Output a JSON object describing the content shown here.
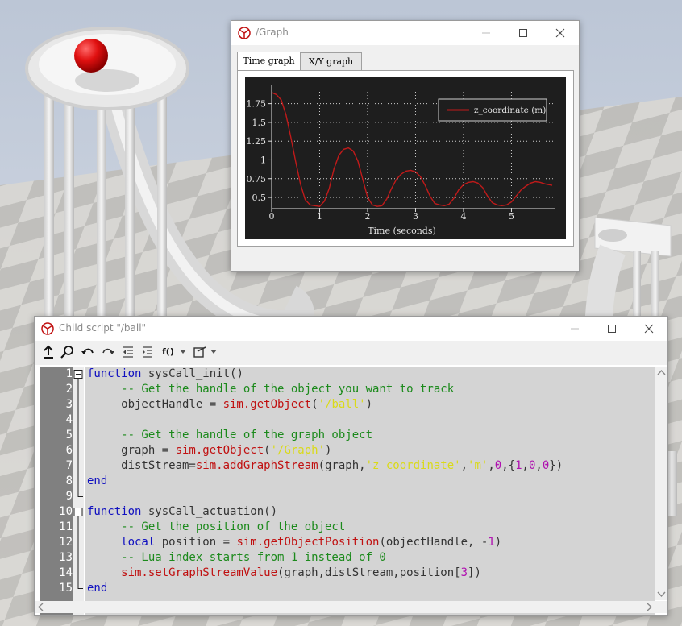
{
  "graph_window": {
    "title": "/Graph",
    "tabs": [
      {
        "label": "Time graph",
        "active": true
      },
      {
        "label": "X/Y graph",
        "active": false
      }
    ]
  },
  "chart_data": {
    "type": "line",
    "xlabel": "Time (seconds)",
    "ylabel": "",
    "xlim": [
      0,
      5.9
    ],
    "ylim": [
      0.35,
      1.95
    ],
    "x_ticks": [
      0,
      1,
      2,
      3,
      4,
      5
    ],
    "y_ticks": [
      0.5,
      0.75,
      1,
      1.25,
      1.5,
      1.75
    ],
    "y_tick_labels": [
      "0.5",
      "0.75",
      "1",
      "1.25",
      "1.5",
      "1.75"
    ],
    "grid": true,
    "legend": "top-right",
    "background": "#1e1e1e",
    "series": [
      {
        "name": "z_coordinate (m)",
        "color": "#c01a1a",
        "x": [
          0,
          0.1,
          0.2,
          0.3,
          0.4,
          0.5,
          0.6,
          0.7,
          0.8,
          0.9,
          1.0,
          1.1,
          1.2,
          1.3,
          1.4,
          1.5,
          1.6,
          1.7,
          1.8,
          1.9,
          2.0,
          2.1,
          2.2,
          2.3,
          2.4,
          2.5,
          2.6,
          2.7,
          2.8,
          2.9,
          3.0,
          3.1,
          3.2,
          3.3,
          3.4,
          3.5,
          3.6,
          3.7,
          3.8,
          3.9,
          4.0,
          4.1,
          4.2,
          4.3,
          4.4,
          4.5,
          4.6,
          4.7,
          4.8,
          4.9,
          5.0,
          5.1,
          5.2,
          5.3,
          5.4,
          5.5,
          5.6,
          5.7,
          5.85
        ],
        "y": [
          1.9,
          1.87,
          1.8,
          1.6,
          1.3,
          0.98,
          0.68,
          0.47,
          0.4,
          0.39,
          0.38,
          0.45,
          0.62,
          0.88,
          1.06,
          1.14,
          1.16,
          1.12,
          0.98,
          0.74,
          0.5,
          0.4,
          0.38,
          0.39,
          0.48,
          0.62,
          0.74,
          0.81,
          0.85,
          0.86,
          0.84,
          0.78,
          0.66,
          0.52,
          0.42,
          0.4,
          0.39,
          0.41,
          0.49,
          0.6,
          0.67,
          0.7,
          0.71,
          0.69,
          0.63,
          0.52,
          0.43,
          0.4,
          0.39,
          0.4,
          0.44,
          0.52,
          0.6,
          0.65,
          0.69,
          0.71,
          0.7,
          0.68,
          0.66
        ]
      }
    ]
  },
  "script_window": {
    "title": "Child script \"/ball\"",
    "toolbar": {
      "func_menu_label": "f()"
    },
    "lines": [
      {
        "n": "1",
        "fold": "box",
        "tokens": [
          {
            "t": "kw",
            "v": "function"
          },
          {
            "t": "p",
            "v": " sysCall_init()"
          }
        ]
      },
      {
        "n": "2",
        "fold": "line",
        "tokens": [
          {
            "t": "cm",
            "v": "     -- Get the handle of the object you want to track"
          }
        ]
      },
      {
        "n": "3",
        "fold": "line",
        "tokens": [
          {
            "t": "p",
            "v": "     objectHandle = "
          },
          {
            "t": "fn",
            "v": "sim.getObject"
          },
          {
            "t": "p",
            "v": "("
          },
          {
            "t": "str",
            "v": "'/ball'"
          },
          {
            "t": "p",
            "v": ")"
          }
        ]
      },
      {
        "n": "4",
        "fold": "line",
        "tokens": []
      },
      {
        "n": "5",
        "fold": "line",
        "tokens": [
          {
            "t": "cm",
            "v": "     -- Get the handle of the graph object"
          }
        ]
      },
      {
        "n": "6",
        "fold": "line",
        "tokens": [
          {
            "t": "p",
            "v": "     graph = "
          },
          {
            "t": "fn",
            "v": "sim.getObject"
          },
          {
            "t": "p",
            "v": "("
          },
          {
            "t": "str",
            "v": "'/Graph'"
          },
          {
            "t": "p",
            "v": ")"
          }
        ]
      },
      {
        "n": "7",
        "fold": "line",
        "tokens": [
          {
            "t": "p",
            "v": "     distStream="
          },
          {
            "t": "fn",
            "v": "sim.addGraphStream"
          },
          {
            "t": "p",
            "v": "(graph,"
          },
          {
            "t": "str",
            "v": "'z coordinate'"
          },
          {
            "t": "p",
            "v": ","
          },
          {
            "t": "str",
            "v": "'m'"
          },
          {
            "t": "p",
            "v": ","
          },
          {
            "t": "num",
            "v": "0"
          },
          {
            "t": "p",
            "v": ",{"
          },
          {
            "t": "num",
            "v": "1"
          },
          {
            "t": "p",
            "v": ","
          },
          {
            "t": "num",
            "v": "0"
          },
          {
            "t": "p",
            "v": ","
          },
          {
            "t": "num",
            "v": "0"
          },
          {
            "t": "p",
            "v": "})"
          }
        ]
      },
      {
        "n": "8",
        "fold": "line",
        "tokens": [
          {
            "t": "kw",
            "v": "end"
          }
        ]
      },
      {
        "n": "9",
        "fold": "end",
        "tokens": []
      },
      {
        "n": "10",
        "fold": "box",
        "tokens": [
          {
            "t": "kw",
            "v": "function"
          },
          {
            "t": "p",
            "v": " sysCall_actuation()"
          }
        ]
      },
      {
        "n": "11",
        "fold": "line",
        "tokens": [
          {
            "t": "cm",
            "v": "     -- Get the position of the object"
          }
        ]
      },
      {
        "n": "12",
        "fold": "line",
        "tokens": [
          {
            "t": "kw",
            "v": "     local"
          },
          {
            "t": "p",
            "v": " position = "
          },
          {
            "t": "fn",
            "v": "sim.getObjectPosition"
          },
          {
            "t": "p",
            "v": "(objectHandle, -"
          },
          {
            "t": "num",
            "v": "1"
          },
          {
            "t": "p",
            "v": ")"
          }
        ]
      },
      {
        "n": "13",
        "fold": "line",
        "tokens": [
          {
            "t": "cm",
            "v": "     -- Lua index starts from 1 instead of 0"
          }
        ]
      },
      {
        "n": "14",
        "fold": "line",
        "tokens": [
          {
            "t": "fn",
            "v": "     sim.setGraphStreamValue"
          },
          {
            "t": "p",
            "v": "(graph,distStream,position["
          },
          {
            "t": "num",
            "v": "3"
          },
          {
            "t": "p",
            "v": "])"
          }
        ]
      },
      {
        "n": "15",
        "fold": "end",
        "tokens": [
          {
            "t": "kw",
            "v": "end"
          }
        ]
      }
    ]
  }
}
